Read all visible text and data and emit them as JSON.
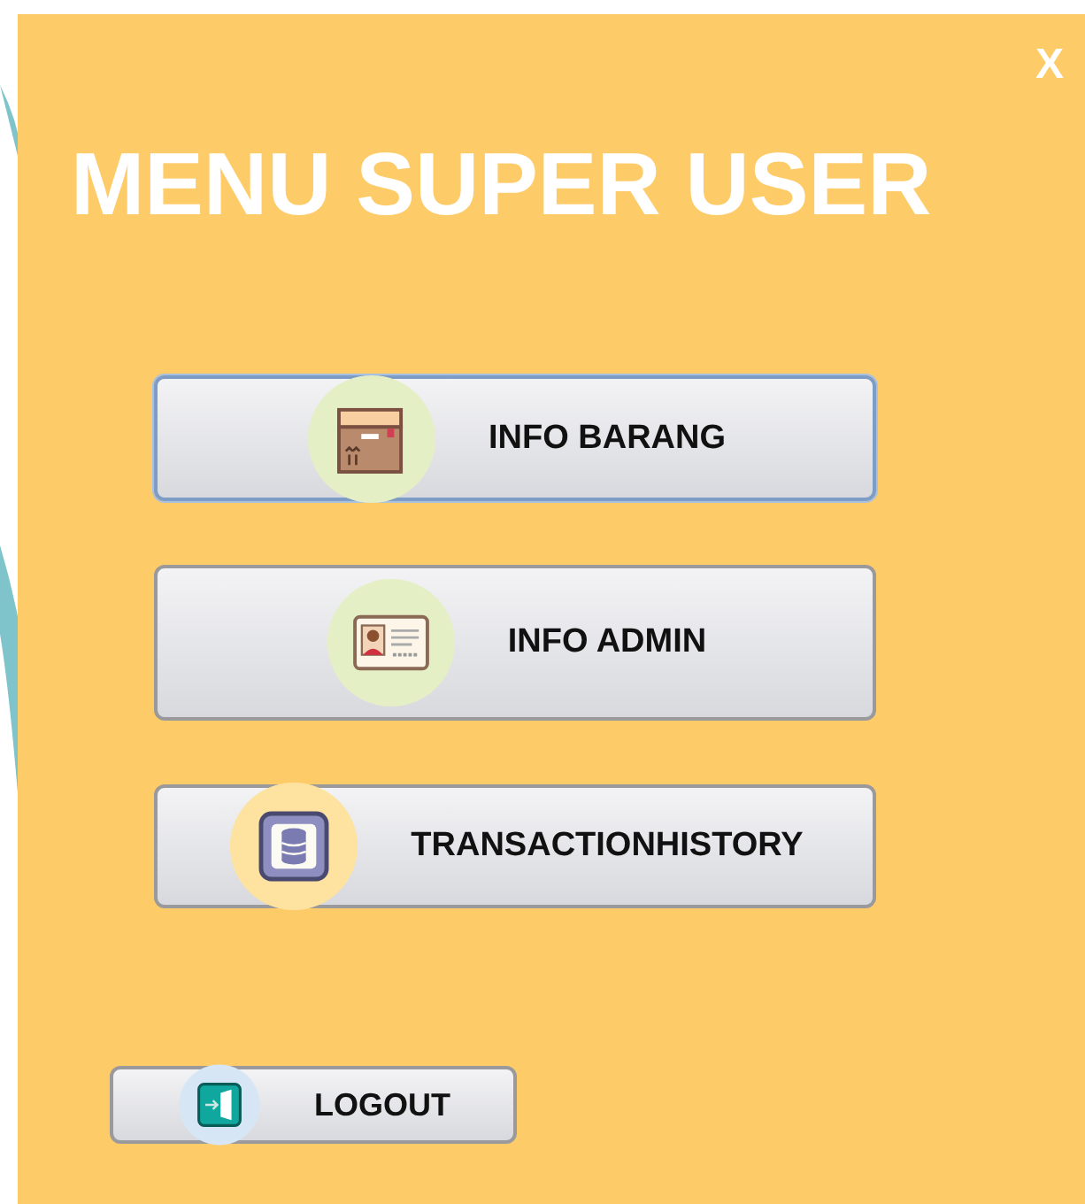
{
  "window": {
    "close": "X",
    "title": "MENU SUPER USER"
  },
  "buttons": [
    {
      "label": "INFO BARANG",
      "kind": "box",
      "focused": true
    },
    {
      "label": "INFO ADMIN",
      "kind": "id-card",
      "focused": false
    },
    {
      "label": "TRANSACTIONHISTORY",
      "kind": "database",
      "focused": false
    }
  ],
  "logout": {
    "label": "LOGOUT",
    "kind": "exit"
  }
}
